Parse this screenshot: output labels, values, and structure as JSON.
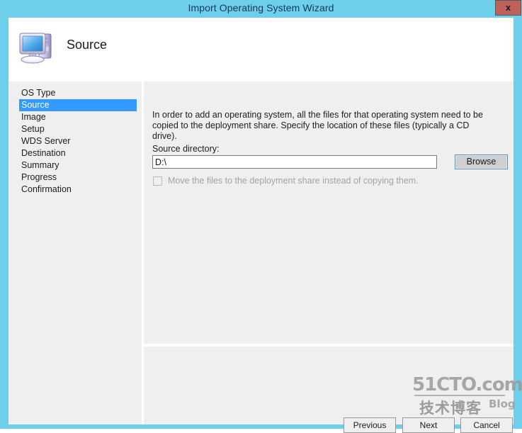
{
  "window": {
    "title": "Import Operating System Wizard",
    "close_label": "x",
    "titlebar_color": "#6ecfea",
    "accent_color": "#3399ff"
  },
  "header": {
    "page_title": "Source",
    "icon": "computer-icon"
  },
  "sidebar": {
    "items": [
      {
        "label": "OS Type",
        "selected": false
      },
      {
        "label": "Source",
        "selected": true
      },
      {
        "label": "Image",
        "selected": false
      },
      {
        "label": "Setup",
        "selected": false
      },
      {
        "label": "WDS Server",
        "selected": false
      },
      {
        "label": "Destination",
        "selected": false
      },
      {
        "label": "Summary",
        "selected": false
      },
      {
        "label": "Progress",
        "selected": false
      },
      {
        "label": "Confirmation",
        "selected": false
      }
    ]
  },
  "content": {
    "intro_text": "In order to add an operating system, all the files for that operating system need to be copied to the deployment share.  Specify the location of these files (typically a CD drive).",
    "source_directory_label": "Source directory:",
    "source_directory_value": "D:\\",
    "source_directory_placeholder": "",
    "browse_label": "Browse",
    "move_checkbox_label": "Move the files to the deployment share instead of copying them.",
    "move_checkbox_checked": false,
    "move_checkbox_enabled": false
  },
  "footer": {
    "previous_label": "Previous",
    "next_label": "Next",
    "cancel_label": "Cancel"
  },
  "watermark": {
    "main": "51CTO.com",
    "chinese": "技术博客",
    "suffix": "Blog"
  }
}
